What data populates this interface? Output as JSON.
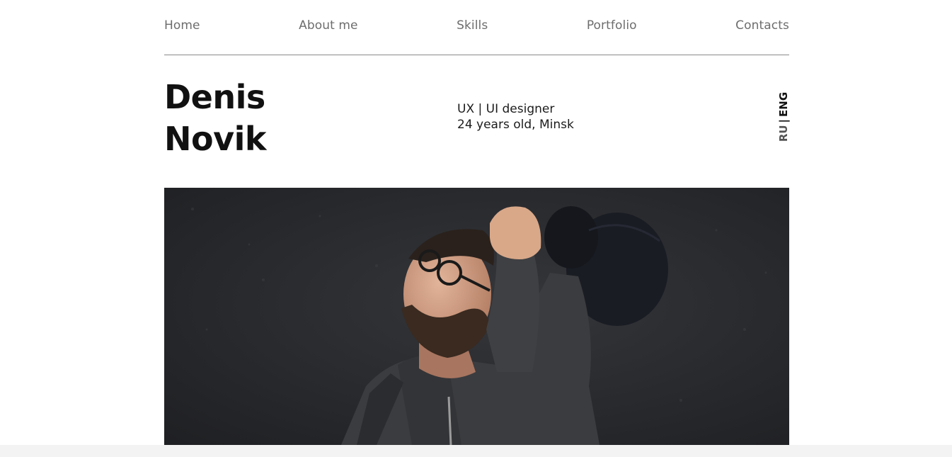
{
  "nav": {
    "items": [
      {
        "label": "Home"
      },
      {
        "label": "About me"
      },
      {
        "label": "Skills"
      },
      {
        "label": "Portfolio"
      },
      {
        "label": "Contacts"
      }
    ]
  },
  "hero": {
    "first_name": "Denis",
    "last_name": "Novik",
    "role": "UX | UI designer",
    "details": "24 years old, Minsk"
  },
  "language": {
    "ru": "RU",
    "separator": "|",
    "eng": "ENG",
    "active": "ENG"
  },
  "photo": {
    "subject": "man-with-glasses-holding-cap-photo"
  },
  "colors": {
    "background": "#ffffff",
    "nav_text": "#6d6d6d",
    "heading": "#111111",
    "divider": "#8a8a8a",
    "photo_bg": "#2a2b2e",
    "footer_strip": "#f3f3f3"
  }
}
